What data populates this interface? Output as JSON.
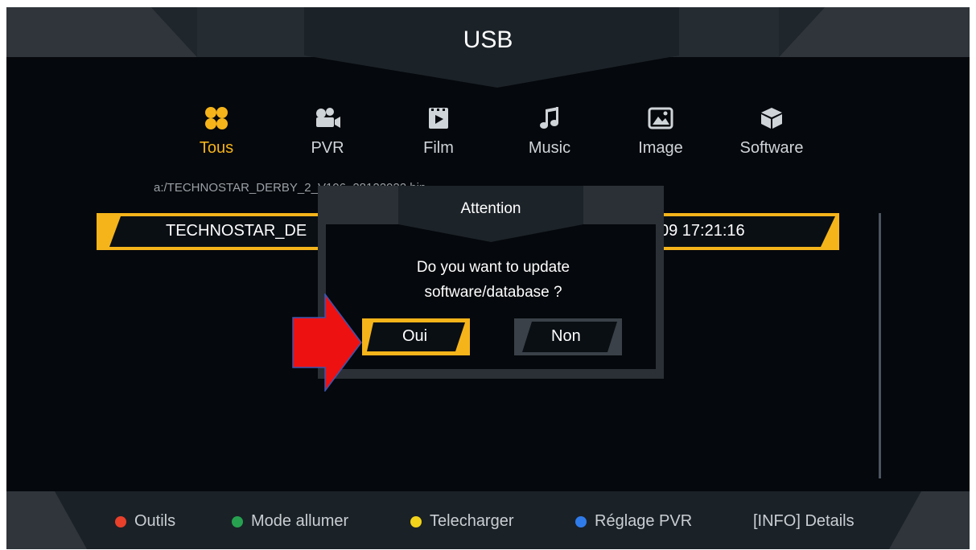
{
  "header": {
    "title": "USB"
  },
  "tabs": [
    {
      "label": "Tous",
      "icon": "grid-icon",
      "active": true
    },
    {
      "label": "PVR",
      "icon": "camera-icon",
      "active": false
    },
    {
      "label": "Film",
      "icon": "film-icon",
      "active": false
    },
    {
      "label": "Music",
      "icon": "music-note-icon",
      "active": false
    },
    {
      "label": "Image",
      "icon": "image-icon",
      "active": false
    },
    {
      "label": "Software",
      "icon": "box-icon",
      "active": false
    }
  ],
  "path": "a:/TECHNOSTAR_DERBY_2_V106_28122022.bin",
  "file_list": [
    {
      "name": "TECHNOSTAR_DE",
      "date": "09 17:21:16",
      "selected": true
    }
  ],
  "dialog": {
    "title": "Attention",
    "message_line1": "Do you want to update",
    "message_line2": "software/database ?",
    "buttons": {
      "yes": "Oui",
      "no": "Non"
    },
    "focused": "yes"
  },
  "footer": {
    "items": [
      {
        "label": "Outils",
        "color": "#e8402a"
      },
      {
        "label": "Mode allumer",
        "color": "#27a150"
      },
      {
        "label": "Telecharger",
        "color": "#f2d21b"
      },
      {
        "label": "Réglage PVR",
        "color": "#2f7bea"
      },
      {
        "label": "[INFO] Details",
        "color": ""
      }
    ]
  },
  "colors": {
    "accent": "#f5b41a",
    "background": "#05080c",
    "annotation_arrow": "#ee1111"
  }
}
